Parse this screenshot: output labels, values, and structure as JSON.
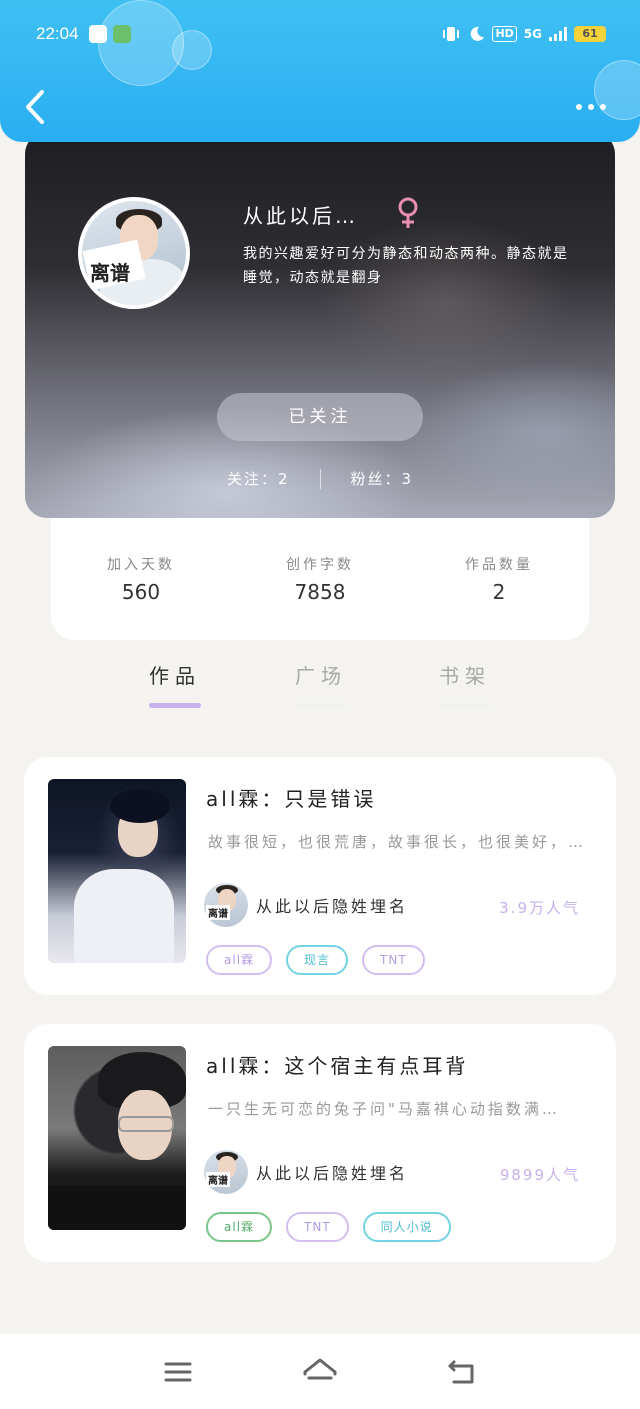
{
  "status_bar": {
    "time": "22:04",
    "network": "5G",
    "hd": "HD",
    "battery": "61"
  },
  "profile": {
    "avatar_text": "离谱",
    "username": "从此以后…",
    "bio": "我的兴趣爱好可分为静态和动态两种。静态就是睡觉，动态就是翻身",
    "follow_label": "已关注",
    "following": "关注：2",
    "fans": "粉丝：3"
  },
  "stats": [
    {
      "label": "加入天数",
      "value": "560"
    },
    {
      "label": "创作字数",
      "value": "7858"
    },
    {
      "label": "作品数量",
      "value": "2"
    }
  ],
  "tabs": [
    {
      "label": "作品",
      "active": true
    },
    {
      "label": "广场",
      "active": false
    },
    {
      "label": "书架",
      "active": false
    }
  ],
  "works": [
    {
      "title": "all霖：只是错误",
      "desc": "故事很短，也很荒唐，故事很长，也很美好，…",
      "author": "从此以后隐姓埋名",
      "popularity": "3.9万人气",
      "tags": [
        {
          "label": "all霖",
          "color": "purple"
        },
        {
          "label": "现言",
          "color": "cyan"
        },
        {
          "label": "TNT",
          "color": "purple"
        }
      ]
    },
    {
      "title": "all霖：这个宿主有点耳背",
      "desc": "一只生无可恋的兔子问\"马嘉祺心动指数满…",
      "author": "从此以后隐姓埋名",
      "popularity": "9899人气",
      "tags": [
        {
          "label": "all霖",
          "color": "green"
        },
        {
          "label": "TNT",
          "color": "purple"
        },
        {
          "label": "同人小说",
          "color": "cyan"
        }
      ]
    }
  ],
  "mini_avatar_text": "离谱",
  "colors": {
    "header": "#2aaef2",
    "accent_purple": "#c7b2ec",
    "tag_cyan": "#74d3e2",
    "tag_green": "#79c58a"
  }
}
